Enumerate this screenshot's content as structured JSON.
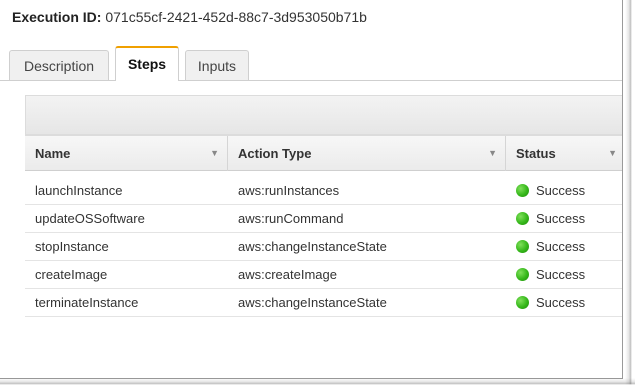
{
  "execution": {
    "label": "Execution ID:",
    "id": "071c55cf-2421-452d-88c7-3d953050b71b"
  },
  "tabs": [
    {
      "label": "Description",
      "active": false
    },
    {
      "label": "Steps",
      "active": true
    },
    {
      "label": "Inputs",
      "active": false
    }
  ],
  "table": {
    "columns": [
      "Name",
      "Action Type",
      "Status"
    ],
    "rows": [
      {
        "name": "launchInstance",
        "action": "aws:runInstances",
        "status": "Success"
      },
      {
        "name": "updateOSSoftware",
        "action": "aws:runCommand",
        "status": "Success"
      },
      {
        "name": "stopInstance",
        "action": "aws:changeInstanceState",
        "status": "Success"
      },
      {
        "name": "createImage",
        "action": "aws:createImage",
        "status": "Success"
      },
      {
        "name": "terminateInstance",
        "action": "aws:changeInstanceState",
        "status": "Success"
      }
    ]
  },
  "colors": {
    "success": "#35b71a",
    "active_tab_accent": "#f0a000"
  },
  "icons": {
    "sort": "chevron-down-icon",
    "status": "status-success-icon"
  }
}
